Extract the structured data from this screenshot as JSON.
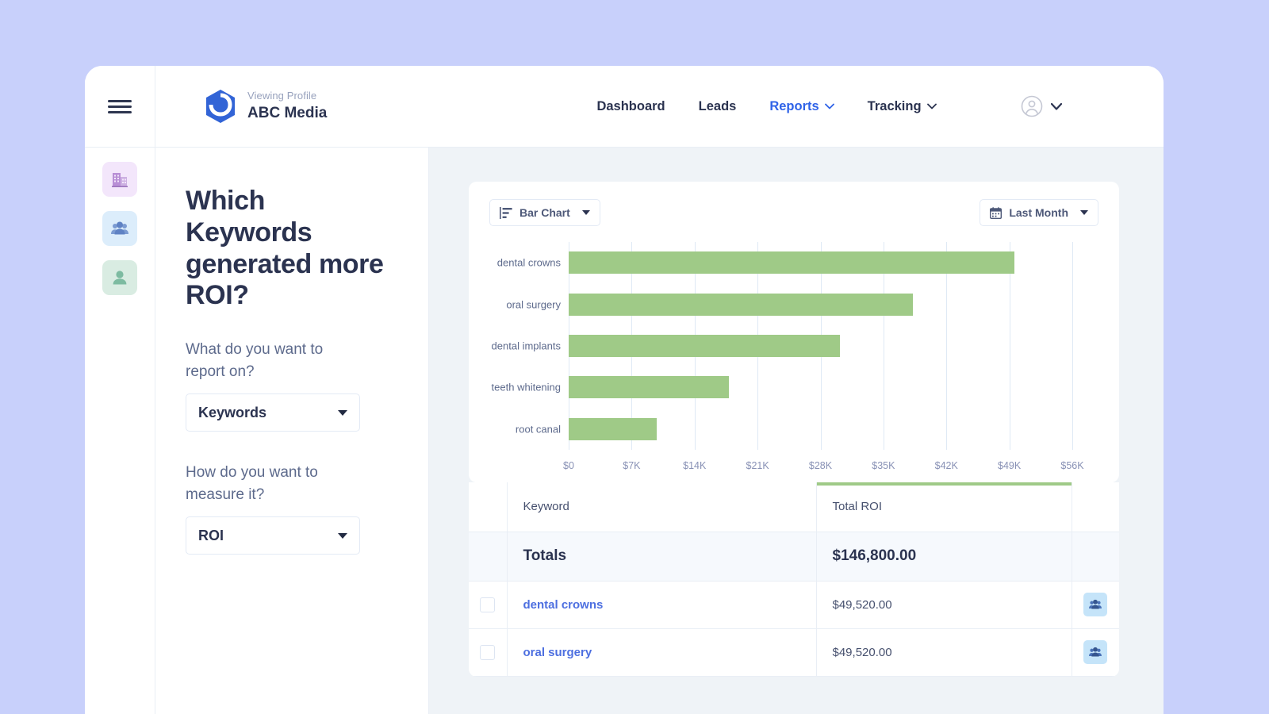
{
  "theme": {
    "page_background": "#c8d0fb",
    "content_background": "#eff3f7",
    "accent_blue": "#2f63e8",
    "bar_green": "#9fca87",
    "text_dark": "#2b3350",
    "text_muted": "#5d6a8c"
  },
  "topbar": {
    "menu_icon": "hamburger-icon",
    "brand": {
      "logo_icon": "hexagon-logo-icon",
      "kicker": "Viewing Profile",
      "name": "ABC Media"
    },
    "nav": [
      {
        "label": "Dashboard",
        "active": false,
        "has_caret": false
      },
      {
        "label": "Leads",
        "active": false,
        "has_caret": false
      },
      {
        "label": "Reports",
        "active": true,
        "has_caret": true
      },
      {
        "label": "Tracking",
        "active": false,
        "has_caret": true
      }
    ],
    "account": {
      "avatar_icon": "user-circle-icon",
      "caret_icon": "chevron-down-icon"
    }
  },
  "icon_rail": [
    {
      "name": "building-icon",
      "tile_color": "#f3e6fb"
    },
    {
      "name": "group-icon",
      "tile_color": "#dcedfb"
    },
    {
      "name": "person-icon",
      "tile_color": "#d9ece2"
    }
  ],
  "question_panel": {
    "title": "Which Keywords generated more ROI?",
    "fields": [
      {
        "label": "What do you want to report on?",
        "value": "Keywords"
      },
      {
        "label": "How do you want to measure it?",
        "value": "ROI"
      }
    ]
  },
  "chart_toolbar": {
    "chart_type": {
      "icon": "bar-chart-icon",
      "label": "Bar Chart"
    },
    "date_range": {
      "icon": "calendar-icon",
      "label": "Last Month"
    }
  },
  "chart_data": {
    "type": "bar",
    "orientation": "horizontal",
    "title": "",
    "xlabel": "",
    "ylabel": "",
    "categories": [
      "dental crowns",
      "oral surgery",
      "dental implants",
      "teeth whitening",
      "root canal"
    ],
    "values": [
      49520,
      38300,
      30200,
      17800,
      9800
    ],
    "xlim": [
      0,
      56000
    ],
    "xticks": [
      0,
      7000,
      14000,
      21000,
      28000,
      35000,
      42000,
      49000,
      56000
    ],
    "xticklabels": [
      "$0",
      "$7K",
      "$14K",
      "$21K",
      "$28K",
      "$35K",
      "$42K",
      "$49K",
      "$56K"
    ],
    "grid": true,
    "legend": "none",
    "bar_color": "#9fca87"
  },
  "table": {
    "columns": [
      "",
      "Keyword",
      "Total ROI",
      ""
    ],
    "totals": {
      "label": "Totals",
      "value": "$146,800.00"
    },
    "rows": [
      {
        "keyword": "dental crowns",
        "total_roi": "$49,520.00",
        "action_icon": "group-icon"
      },
      {
        "keyword": "oral surgery",
        "total_roi": "$49,520.00",
        "action_icon": "group-icon"
      }
    ]
  }
}
